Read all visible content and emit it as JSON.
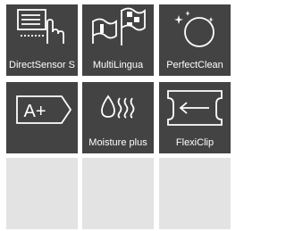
{
  "features": [
    {
      "label": "DirectSensor S",
      "icon": "directsensor-touch-icon"
    },
    {
      "label": "MultiLingua",
      "icon": "flags-icon"
    },
    {
      "label": "PerfectClean",
      "icon": "sparkle-circle-icon"
    },
    {
      "label": "",
      "icon": "energy-class-a-plus-icon",
      "badge_text": "A+"
    },
    {
      "label": "Moisture plus",
      "icon": "moisture-steam-icon"
    },
    {
      "label": "FlexiClip",
      "icon": "telescopic-runner-icon"
    }
  ],
  "empty_tiles": 3,
  "colors": {
    "tile": "#434343",
    "empty_tile": "#e3e3e4",
    "text": "#ffffff",
    "background": "#ffffff"
  }
}
